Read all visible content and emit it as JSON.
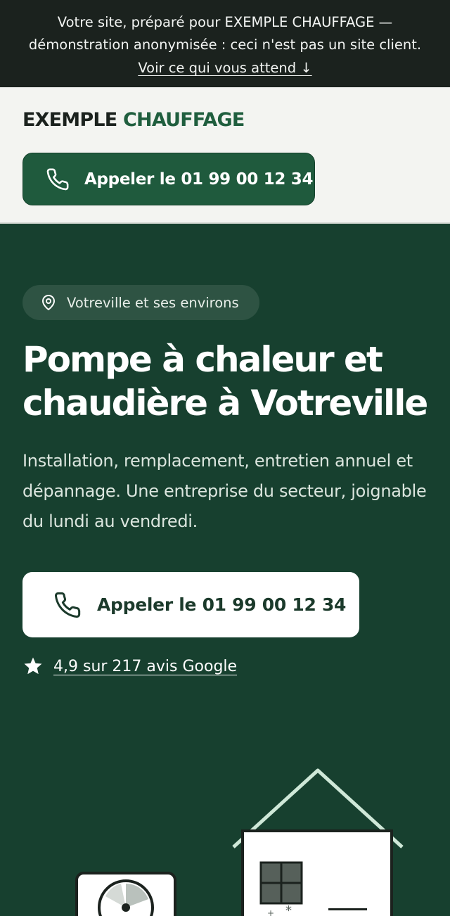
{
  "banner": {
    "line1": "Votre site, préparé pour EXEMPLE CHAUFFAGE —",
    "line2": "démonstration anonymisée : ceci n'est pas un site client.",
    "link": "Voir ce qui vous attend ↓"
  },
  "header": {
    "logo_part1": "EXEMPLE",
    "logo_part2": "CHAUFFAGE",
    "cta_label": "Appeler le 01 99 00 12 34"
  },
  "hero": {
    "location": "Votreville et ses environs",
    "title": "Pompe à chaleur et chaudière à Votreville",
    "lead": "Installation, remplacement, entretien annuel et dépannage. Une entreprise du secteur, joignable du lundi au vendredi.",
    "cta_label": "Appeler le 01 99 00 12 34",
    "reviews": "4,9 sur 217 avis Google"
  },
  "colors": {
    "brand_green": "#1f5a3d",
    "hero_bg": "#17402f",
    "banner_bg": "#1b221e"
  }
}
